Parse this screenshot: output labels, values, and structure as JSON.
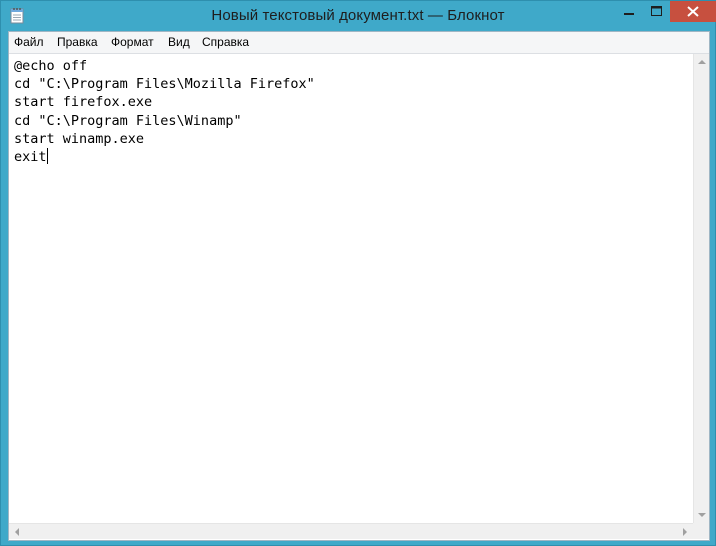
{
  "window": {
    "title": "Новый текстовый документ.txt — Блокнот",
    "frame_color": "#3fa9c9",
    "close_color": "#c7503f"
  },
  "icons": {
    "app": "notepad-icon",
    "minimize": "minimize-icon",
    "maximize": "maximize-icon",
    "close": "close-icon"
  },
  "menu": {
    "items": [
      {
        "label": "Файл"
      },
      {
        "label": "Правка"
      },
      {
        "label": "Формат"
      },
      {
        "label": "Вид"
      },
      {
        "label": "Справка"
      }
    ]
  },
  "editor": {
    "lines": [
      "@echo off",
      "cd \"C:\\Program Files\\Mozilla Firefox\"",
      "start firefox.exe",
      "cd \"C:\\Program Files\\Winamp\"",
      "start winamp.exe",
      "exit"
    ]
  }
}
